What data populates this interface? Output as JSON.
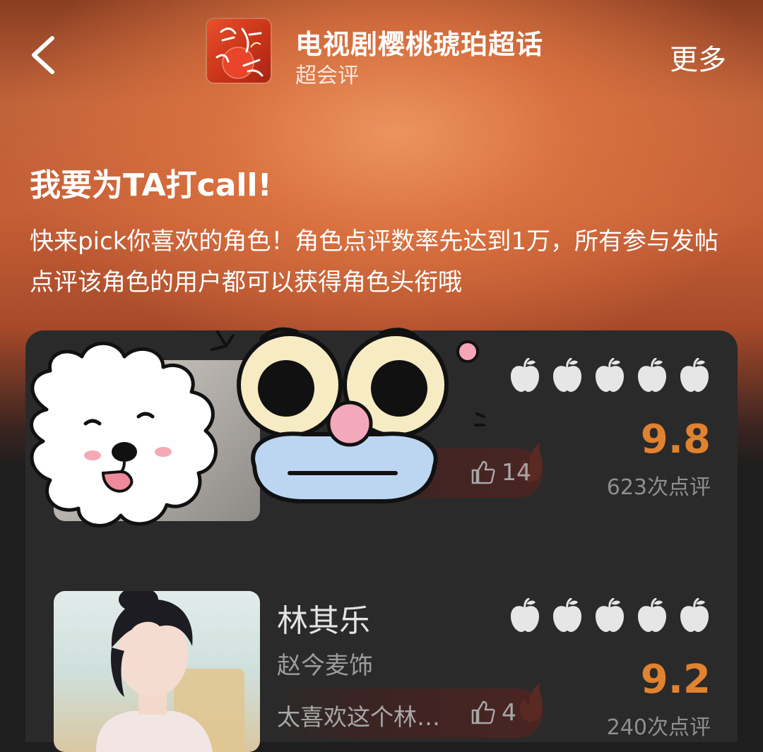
{
  "header": {
    "title": "电视剧樱桃琥珀超话",
    "subtitle": "超会评",
    "more_label": "更多",
    "logo_text": "樱桃琥珀"
  },
  "intro": {
    "heading": "我要为TA打call!",
    "description": "快来pick你喜欢的角色！角色点评数率先达到1万，所有参与发帖点评该角色的用户都可以获得角色头衔哦"
  },
  "characters": [
    {
      "name": "",
      "actor": "",
      "comment": "",
      "likes": "14",
      "score": "9.8",
      "review_count": "623次点评",
      "rating_fraction": 1.0
    },
    {
      "name": "林其乐",
      "actor": "赵今麦饰",
      "comment": "太喜欢这个林…",
      "likes": "4",
      "score": "9.2",
      "review_count": "240次点评",
      "rating_fraction": 1.0
    }
  ],
  "colors": {
    "accent": "#e0822f",
    "card_bg": "#2a2a2a",
    "apple": "#e6e6e6"
  }
}
